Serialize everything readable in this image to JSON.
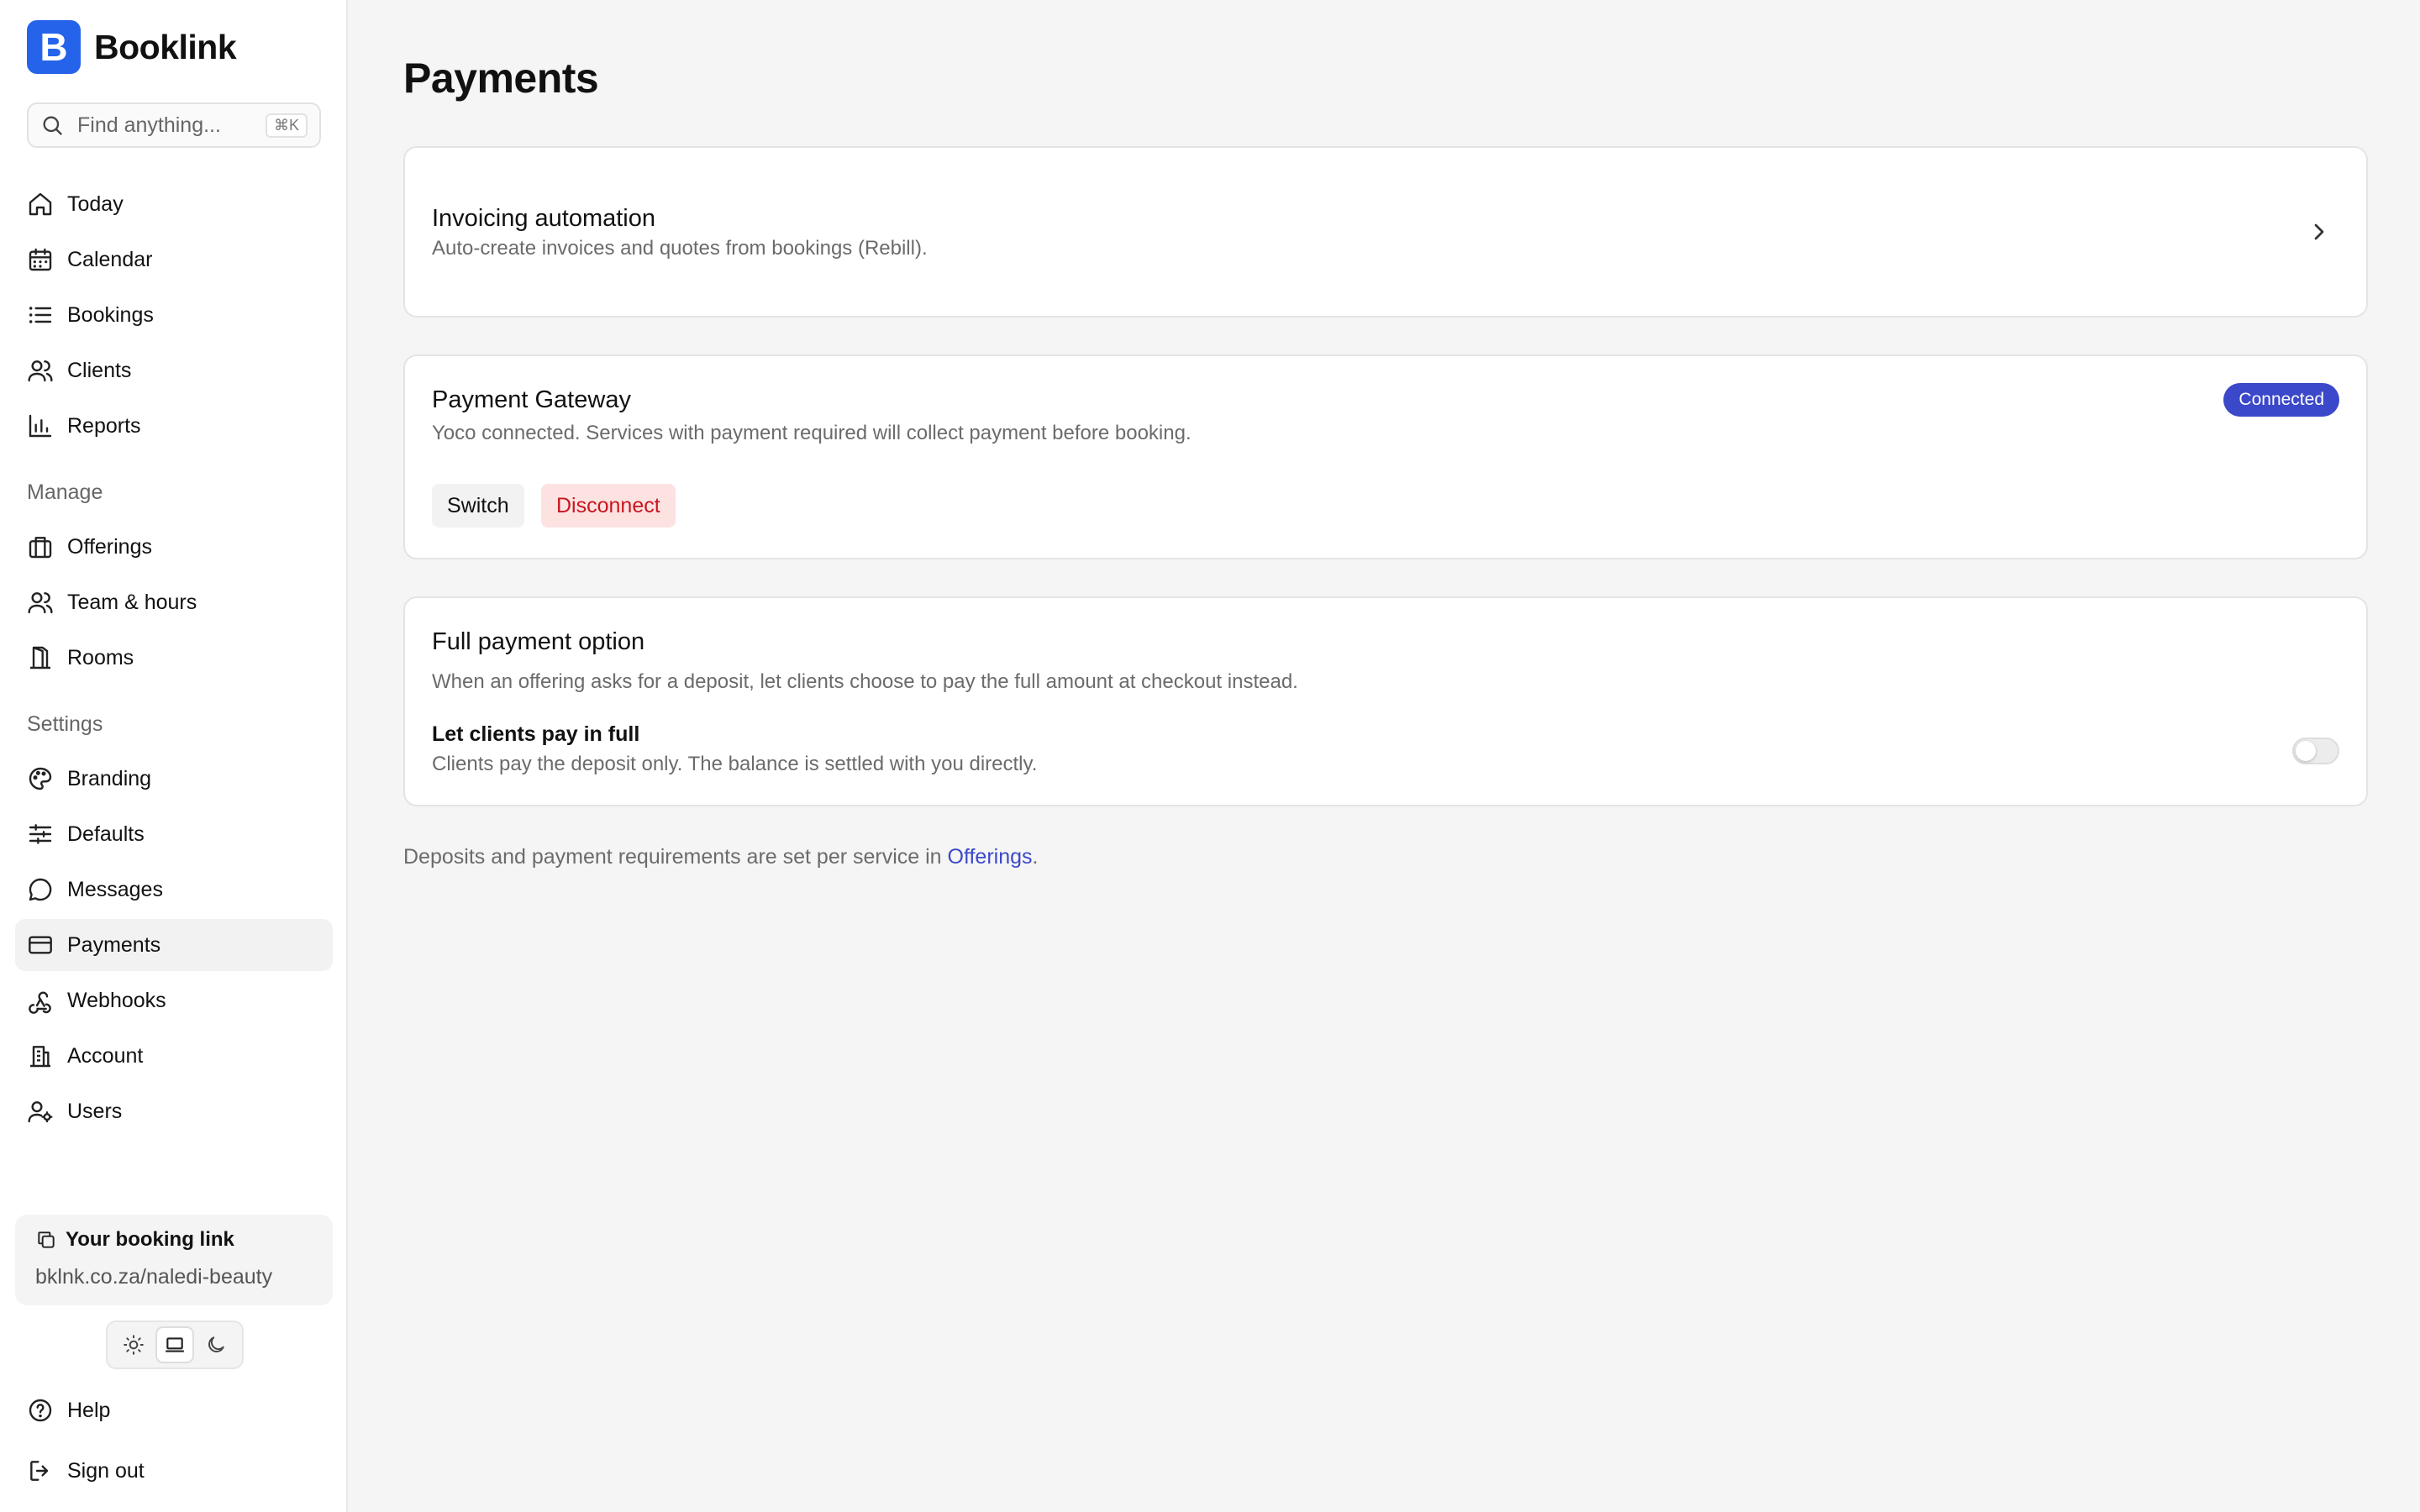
{
  "app": {
    "name": "Booklink",
    "logo_letter": "B"
  },
  "search": {
    "placeholder": "Find anything...",
    "shortcut": "⌘K"
  },
  "sidebar": {
    "primary": [
      {
        "label": "Today",
        "icon": "home-icon"
      },
      {
        "label": "Calendar",
        "icon": "calendar-icon"
      },
      {
        "label": "Bookings",
        "icon": "list-icon"
      },
      {
        "label": "Clients",
        "icon": "users-icon"
      },
      {
        "label": "Reports",
        "icon": "bar-chart-icon"
      }
    ],
    "manage_label": "Manage",
    "manage": [
      {
        "label": "Offerings",
        "icon": "briefcase-icon"
      },
      {
        "label": "Team & hours",
        "icon": "team-icon"
      },
      {
        "label": "Rooms",
        "icon": "door-icon"
      }
    ],
    "settings_label": "Settings",
    "settings": [
      {
        "label": "Branding",
        "icon": "palette-icon"
      },
      {
        "label": "Defaults",
        "icon": "sliders-icon"
      },
      {
        "label": "Messages",
        "icon": "message-icon"
      },
      {
        "label": "Payments",
        "icon": "credit-card-icon",
        "active": true
      },
      {
        "label": "Webhooks",
        "icon": "webhook-icon"
      },
      {
        "label": "Account",
        "icon": "building-icon"
      },
      {
        "label": "Users",
        "icon": "user-cog-icon"
      }
    ],
    "booking_link": {
      "title": "Your booking link",
      "url": "bklnk.co.za/naledi-beauty"
    },
    "theme_modes": [
      "light",
      "system",
      "dark"
    ],
    "theme_active": "system",
    "bottom": [
      {
        "label": "Help",
        "icon": "help-icon"
      },
      {
        "label": "Sign out",
        "icon": "sign-out-icon"
      }
    ]
  },
  "main": {
    "title": "Payments",
    "invoicing": {
      "title": "Invoicing automation",
      "subtitle": "Auto-create invoices and quotes from bookings (Rebill)."
    },
    "gateway": {
      "title": "Payment Gateway",
      "subtitle": "Yoco connected. Services with payment required will collect payment before booking.",
      "status": "Connected",
      "switch_label": "Switch",
      "disconnect_label": "Disconnect"
    },
    "full_payment": {
      "title": "Full payment option",
      "subtitle": "When an offering asks for a deposit, let clients choose to pay the full amount at checkout instead.",
      "toggle_label": "Let clients pay in full",
      "toggle_desc": "Clients pay the deposit only. The balance is settled with you directly.",
      "enabled": false
    },
    "footer": {
      "text": "Deposits and payment requirements are set per service in ",
      "link": "Offerings",
      "suffix": "."
    }
  },
  "colors": {
    "brand": "#2563eb",
    "accent": "#3b48c9",
    "danger": "#c8161d",
    "danger_bg": "#fde2e2"
  }
}
